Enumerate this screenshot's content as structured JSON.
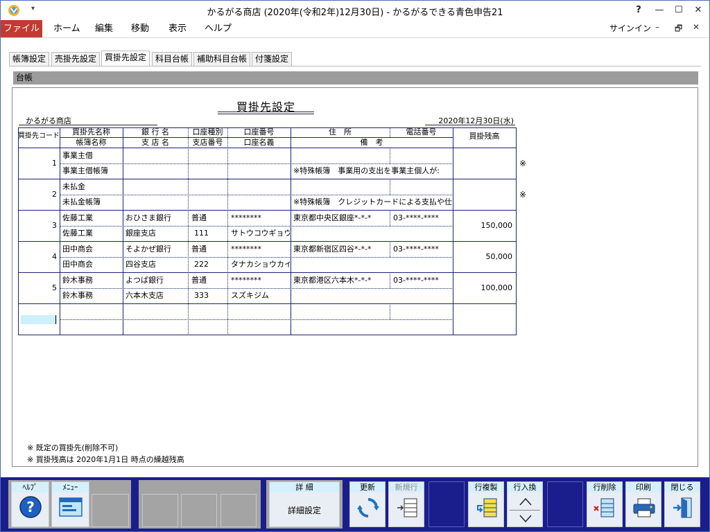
{
  "window": {
    "title": "かるがる商店 (2020年(令和2年)12月30日) - かるがるできる青色申告21",
    "help_glyph": "?",
    "minimize_glyph": "—",
    "maximize_glyph": "☐",
    "close_glyph": "✕",
    "qat_glyph": "▾"
  },
  "menu": {
    "items": [
      "ファイル",
      "ホーム",
      "編集",
      "移動",
      "表示",
      "ヘルプ"
    ],
    "signin": "サインイン",
    "min_glyph": "–",
    "restore_glyph": "🗗",
    "close_glyph": "✕"
  },
  "tabs": [
    "帳簿設定",
    "売掛先設定",
    "買掛先設定",
    "科目台帳",
    "補助科目台帳",
    "付箋設定"
  ],
  "active_tab_index": 2,
  "section_title": "台帳",
  "form": {
    "heading": "買掛先設定",
    "company": "かるがる商店",
    "date": "2020年12月30日(水)"
  },
  "table": {
    "headers": {
      "code": "買掛先コード",
      "name": "買掛先名称",
      "book_name": "帳簿名称",
      "bank": "銀 行 名",
      "branch": "支 店 名",
      "acct_type": "口座種別",
      "branch_no": "支店番号",
      "acct_no": "口座番号",
      "acct_name": "口座名義",
      "address": "住　所",
      "phone": "電話番号",
      "remarks": "備　考",
      "balance": "買掛残高"
    },
    "rows": [
      {
        "no": "1",
        "name": "事業主借",
        "book": "事業主借帳簿",
        "bank": "",
        "branch": "",
        "type": "",
        "branch_no": "",
        "acct_no": "",
        "acct_name": "",
        "address": "",
        "phone": "",
        "remark": "※特殊帳簿　事業用の支出を事業主個人が:",
        "balance": "",
        "mark": "※"
      },
      {
        "no": "2",
        "name": "未払金",
        "book": "未払金帳簿",
        "bank": "",
        "branch": "",
        "type": "",
        "branch_no": "",
        "acct_no": "",
        "acct_name": "",
        "address": "",
        "phone": "",
        "remark": "※特殊帳簿　クレジットカードによる支払や仕",
        "balance": "",
        "mark": "※"
      },
      {
        "no": "3",
        "name": "佐藤工業",
        "book": "佐藤工業",
        "bank": "おひさま銀行",
        "branch": "銀座支店",
        "type": "普通",
        "branch_no": "111",
        "acct_no": "********",
        "acct_name": "サトウコウギョウ",
        "address": "東京都中央区銀座*-*-*",
        "phone": "03-****-****",
        "remark": "",
        "balance": "150,000",
        "mark": ""
      },
      {
        "no": "4",
        "name": "田中商会",
        "book": "田中商会",
        "bank": "そよかぜ銀行",
        "branch": "四谷支店",
        "type": "普通",
        "branch_no": "222",
        "acct_no": "********",
        "acct_name": "タナカショウカイ",
        "address": "東京都新宿区四谷*-*-*",
        "phone": "03-****-****",
        "remark": "",
        "balance": "50,000",
        "mark": ""
      },
      {
        "no": "5",
        "name": "鈴木事務",
        "book": "鈴木事務",
        "bank": "よつば銀行",
        "branch": "六本木支店",
        "type": "普通",
        "branch_no": "333",
        "acct_no": "********",
        "acct_name": "スズキジム",
        "address": "東京都港区六本木*-*-*",
        "phone": "03-****-****",
        "remark": "",
        "balance": "100,000",
        "mark": ""
      }
    ]
  },
  "notes": [
    "※ 既定の買掛先(削除不可)",
    "※ 買掛残高は 2020年1月1日 時点の繰越残高"
  ],
  "toolbar": {
    "help": "ﾍﾙﾌﾟ",
    "menu": "ﾒﾆｭｰ",
    "detail_label": "詳 細",
    "detail_button": "詳細設定",
    "refresh": "更新",
    "new_row": "新規行",
    "copy_row": "行複製",
    "swap_row": "行入換",
    "delete_row": "行削除",
    "print": "印刷",
    "close": "閉じる"
  },
  "colors": {
    "accent_menu": "#c43a33",
    "toolbar_bg": "#1a1e8c",
    "grid_line": "#1b2370",
    "selected_cell": "#cdf0fa"
  }
}
